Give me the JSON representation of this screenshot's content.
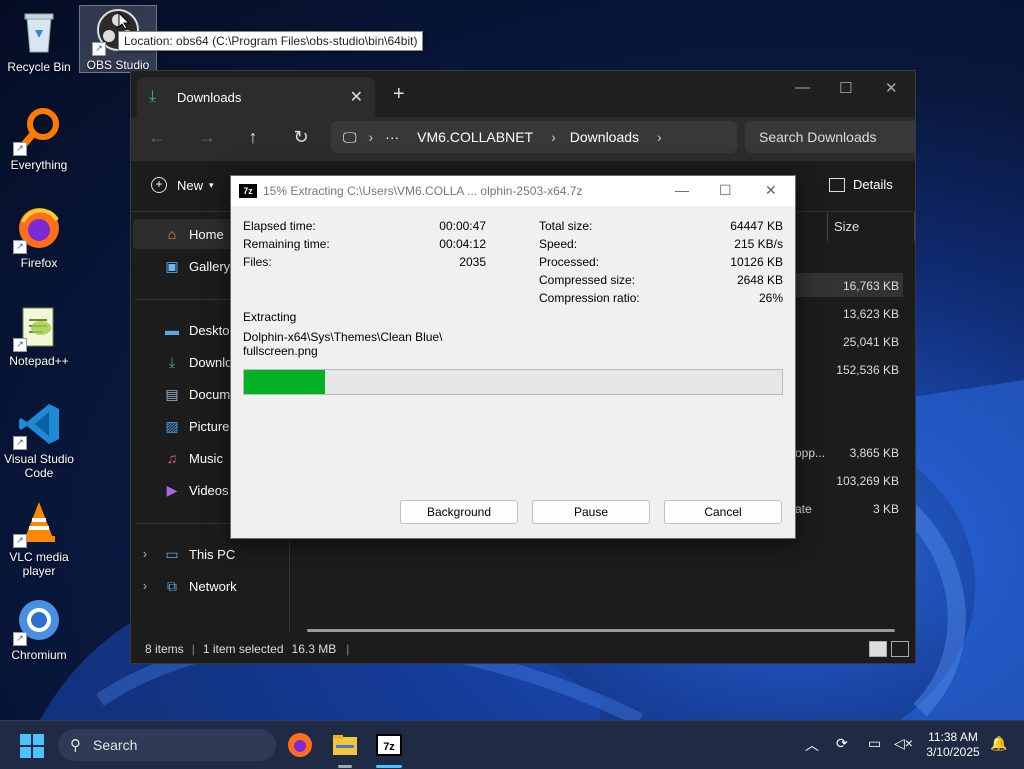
{
  "desktop": {
    "icons": [
      {
        "label": "Recycle Bin",
        "icon": "recycle-bin-icon"
      },
      {
        "label": "OBS Studio",
        "icon": "obs-icon"
      },
      {
        "label": "Everything",
        "icon": "everything-icon"
      },
      {
        "label": "Firefox",
        "icon": "firefox-icon"
      },
      {
        "label": "Notepad++",
        "icon": "notepadpp-icon"
      },
      {
        "label": "Visual Studio Code",
        "icon": "vscode-icon"
      },
      {
        "label": "VLC media player",
        "icon": "vlc-icon"
      },
      {
        "label": "Chromium",
        "icon": "chromium-icon"
      }
    ],
    "tooltip": "Location: obs64 (C:\\Program Files\\obs-studio\\bin\\64bit)"
  },
  "explorer": {
    "tab_label": "Downloads",
    "address": {
      "segments": [
        "VM6.COLLABNET",
        "Downloads"
      ],
      "ellipsis": "···"
    },
    "search_placeholder": "Search Downloads",
    "cmd": {
      "new_label": "New",
      "details_label": "Details"
    },
    "sidebar": [
      {
        "label": "Home",
        "icon": "home-icon",
        "selected": true
      },
      {
        "label": "Gallery",
        "icon": "gallery-icon"
      },
      {
        "label": "Desktop",
        "icon": "desktop-icon"
      },
      {
        "label": "Downloa",
        "icon": "download-icon"
      },
      {
        "label": "Docume",
        "icon": "documents-icon"
      },
      {
        "label": "Pictures",
        "icon": "pictures-icon"
      },
      {
        "label": "Music",
        "icon": "music-icon"
      },
      {
        "label": "Videos",
        "icon": "videos-icon"
      },
      {
        "label": "This PC",
        "icon": "pc-icon"
      },
      {
        "label": "Network",
        "icon": "network-icon"
      }
    ],
    "column_size": "Size",
    "sizes": [
      "16,763 KB",
      "13,623 KB",
      "25,041 KB",
      "152,536 KB",
      "3,865 KB",
      "103,269 KB",
      "3 KB"
    ],
    "row_fragments": {
      "r5": "opp...",
      "r7": "ate"
    },
    "status": {
      "items": "8 items",
      "selected": "1 item selected",
      "size": "16.3 MB"
    }
  },
  "zip": {
    "title": "15% Extracting C:\\Users\\VM6.COLLA ... olphin-2503-x64.7z",
    "logo": "7z",
    "left": [
      {
        "label": "Elapsed time:",
        "value": "00:00:47"
      },
      {
        "label": "Remaining time:",
        "value": "00:04:12"
      },
      {
        "label": "Files:",
        "value": "2035"
      }
    ],
    "right": [
      {
        "label": "Total size:",
        "value": "64447 KB"
      },
      {
        "label": "Speed:",
        "value": "215 KB/s"
      },
      {
        "label": "Processed:",
        "value": "10126 KB"
      },
      {
        "label": "Compressed size:",
        "value": "2648 KB"
      },
      {
        "label": "Compression ratio:",
        "value": "26%"
      }
    ],
    "status_label": "Extracting",
    "current_file_line1": "Dolphin-x64\\Sys\\Themes\\Clean Blue\\",
    "current_file_line2": "fullscreen.png",
    "progress": 0.15,
    "progress_color": "#06b025",
    "buttons": {
      "background": "Background",
      "pause": "Pause",
      "cancel": "Cancel"
    }
  },
  "taskbar": {
    "search_label": "Search",
    "time": "11:38 AM",
    "date": "3/10/2025"
  }
}
